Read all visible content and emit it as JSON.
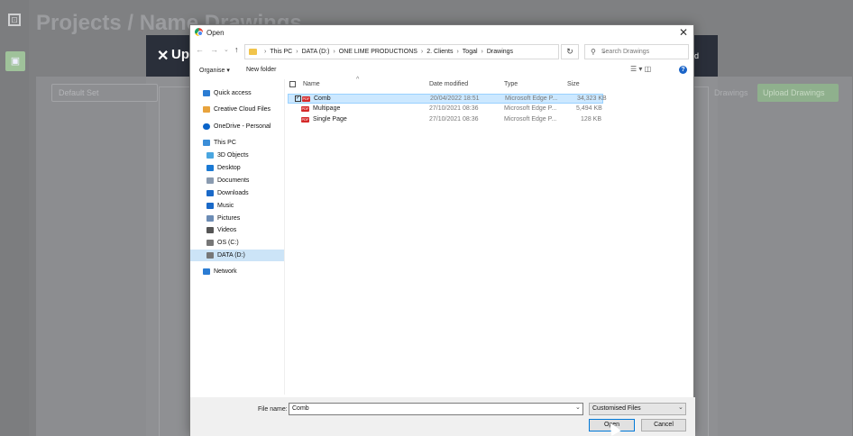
{
  "app": {
    "title": "Projects / Name Drawings",
    "header_title": "Up",
    "header_close": "✕",
    "header_right": "d",
    "default_set": "Default Set",
    "drawings_label": "Drawings",
    "upload_button": "Upload Drawings",
    "colors": {
      "header": "#2a2f3a",
      "upload": "#8fb08d"
    }
  },
  "dialog": {
    "title": "Open",
    "close_label": "✕",
    "nav": {
      "back": "←",
      "forward": "→",
      "dropdown": "⌄",
      "up": "↑"
    },
    "breadcrumb": [
      "This PC",
      "DATA (D:)",
      "ONE LIME PRODUCTIONS",
      "2. Clients",
      "Togal",
      "Drawings"
    ],
    "refresh": "↻",
    "search_placeholder": "Search Drawings",
    "toolbar": {
      "organise": "Organise ▾",
      "new_folder": "New folder",
      "view_icons": "☰ ▾  ◫"
    },
    "help": "?",
    "nav_pane": [
      {
        "label": "Quick access",
        "icon": "star-icon",
        "color": "#2b7cd3"
      },
      {
        "label": "Creative Cloud Files",
        "icon": "cloud-folder-icon",
        "color": "#e8a33d"
      },
      {
        "label": "OneDrive - Personal",
        "icon": "onedrive-icon",
        "color": "#0a64c9"
      },
      {
        "label": "This PC",
        "icon": "pc-icon",
        "color": "#3b8ed8"
      },
      {
        "label": "3D Objects",
        "icon": "cube-icon",
        "color": "#4aa6e0"
      },
      {
        "label": "Desktop",
        "icon": "desktop-icon",
        "color": "#1a79d4"
      },
      {
        "label": "Documents",
        "icon": "documents-icon",
        "color": "#8a9bb0"
      },
      {
        "label": "Downloads",
        "icon": "download-icon",
        "color": "#1a69c8"
      },
      {
        "label": "Music",
        "icon": "music-icon",
        "color": "#1a69c8"
      },
      {
        "label": "Pictures",
        "icon": "pictures-icon",
        "color": "#6c8cb5"
      },
      {
        "label": "Videos",
        "icon": "videos-icon",
        "color": "#555"
      },
      {
        "label": "OS (C:)",
        "icon": "drive-icon",
        "color": "#777"
      },
      {
        "label": "DATA (D:)",
        "icon": "drive-icon",
        "color": "#777"
      },
      {
        "label": "Network",
        "icon": "network-icon",
        "color": "#2b7cd3"
      }
    ],
    "columns": {
      "name": "Name",
      "date": "Date modified",
      "type": "Type",
      "size": "Size"
    },
    "sort_arrow": "^",
    "files": [
      {
        "name": "Comb",
        "date": "20/04/2022 18:51",
        "type": "Microsoft Edge P...",
        "size": "34,323 KB",
        "selected": true
      },
      {
        "name": "Multipage",
        "date": "27/10/2021 08:36",
        "type": "Microsoft Edge P...",
        "size": "5,494 KB",
        "selected": false
      },
      {
        "name": "Single Page",
        "date": "27/10/2021 08:36",
        "type": "Microsoft Edge P...",
        "size": "128 KB",
        "selected": false
      }
    ],
    "file_name_label": "File name:",
    "file_name_value": "Comb",
    "filter_value": "Customised Files",
    "open_button": "Open",
    "cancel_button": "Cancel"
  }
}
